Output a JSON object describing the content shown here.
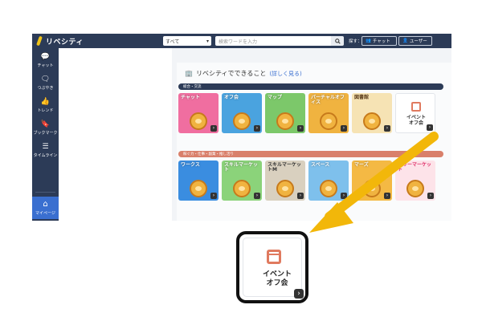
{
  "topbar": {
    "logo_text": "リベシティ",
    "scope_label": "すべて",
    "search_placeholder": "検索ワードを入力",
    "sagasu_label": "探す：",
    "chat_label": "チャット",
    "user_label": "ユーザー"
  },
  "sidebar": {
    "items": [
      {
        "label": "チャット",
        "icon": "chat-icon"
      },
      {
        "label": "つぶやき",
        "icon": "tweet-icon"
      },
      {
        "label": "トレンド",
        "icon": "thumbs-up-icon"
      },
      {
        "label": "ブックマーク",
        "icon": "bookmark-icon"
      },
      {
        "label": "タイムライン",
        "icon": "list-icon"
      },
      {
        "label": "マイページ",
        "icon": "home-icon"
      }
    ]
  },
  "main": {
    "title": "リベシティでできること",
    "title_link": "(詳しく見る)",
    "section1": "総合・交流",
    "section2": "稼ぐ力・仕事・副業・推し活り",
    "tiles_row1": [
      {
        "label": "チャット",
        "color": "#f06ea0"
      },
      {
        "label": "オフ会",
        "color": "#4aa3df"
      },
      {
        "label": "マップ",
        "color": "#7cc86a"
      },
      {
        "label": "バーチャルオフィス",
        "color": "#f0b340"
      },
      {
        "label": "図書館",
        "color": "#f6e3b4"
      }
    ],
    "event_tile_label": "イベント\nオフ会",
    "tiles_row2": [
      {
        "label": "ワークス",
        "color": "#3a8de0"
      },
      {
        "label": "スキルマーケット",
        "color": "#8bd37a"
      },
      {
        "label": "スキルマーケットM",
        "color": "#d9d0bf"
      },
      {
        "label": "スペース",
        "color": "#7ec0ec"
      },
      {
        "label": "マーズ",
        "color": "#f4b944"
      },
      {
        "label": "フリーマーケット",
        "color": "#fde3e9"
      }
    ]
  },
  "zoom": {
    "label_line1": "イベント",
    "label_line2": "オフ会"
  },
  "colors": {
    "navy": "#2c3b57",
    "accent_blue": "#3a6fd0",
    "section1_bar": "#2c3b57",
    "section2_bar": "#d9806b",
    "arrow": "#f2b70a",
    "event_icon": "#e07a5f"
  }
}
